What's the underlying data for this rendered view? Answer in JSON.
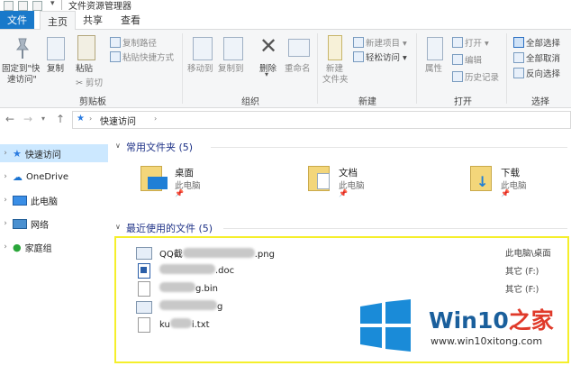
{
  "window": {
    "title": "文件资源管理器"
  },
  "tabs": {
    "file": "文件",
    "home": "主页",
    "share": "共享",
    "view": "查看"
  },
  "ribbon": {
    "clipboard": {
      "pin_quick_access_l1": "固定到\"快",
      "pin_quick_access_l2": "速访问\"",
      "copy": "复制",
      "paste": "粘贴",
      "copy_path": "复制路径",
      "paste_shortcut": "粘贴快捷方式",
      "cut": "剪切",
      "label": "剪贴板"
    },
    "organize": {
      "move_to": "移动到",
      "copy_to": "复制到",
      "delete": "删除",
      "rename": "重命名",
      "label": "组织"
    },
    "new": {
      "new_folder_l1": "新建",
      "new_folder_l2": "文件夹",
      "new_item": "新建项目",
      "easy_access": "轻松访问",
      "label": "新建"
    },
    "open": {
      "properties": "属性",
      "open": "打开",
      "edit": "编辑",
      "history": "历史记录",
      "label": "打开"
    },
    "select": {
      "select_all": "全部选择",
      "select_none": "全部取消",
      "invert": "反向选择",
      "label": "选择"
    }
  },
  "address": {
    "path": "快速访问"
  },
  "nav_pane": {
    "items": [
      {
        "label": "快速访问",
        "icon": "star-icon"
      },
      {
        "label": "OneDrive",
        "icon": "cloud-icon"
      },
      {
        "label": "此电脑",
        "icon": "computer-icon"
      },
      {
        "label": "网络",
        "icon": "network-icon"
      },
      {
        "label": "家庭组",
        "icon": "homegroup-icon"
      }
    ]
  },
  "frequent": {
    "header": "常用文件夹 (5)",
    "folders": [
      {
        "name": "桌面",
        "loc": "此电脑"
      },
      {
        "name": "文档",
        "loc": "此电脑"
      },
      {
        "name": "下载",
        "loc": "此电脑"
      }
    ]
  },
  "recent": {
    "header": "最近使用的文件 (5)",
    "files": [
      {
        "prefix": "QQ截",
        "suffix": ".png",
        "loc": "此电脑\\桌面"
      },
      {
        "prefix": "",
        "suffix": ".doc",
        "loc": "其它 (F:)"
      },
      {
        "prefix": "",
        "suffix": "g.bin",
        "loc": "其它 (F:)"
      },
      {
        "prefix": "",
        "suffix": "g",
        "loc": ""
      },
      {
        "prefix": "ku",
        "suffix": "i.txt",
        "loc": ""
      }
    ]
  },
  "watermark": {
    "brand_a": "Win10",
    "brand_b": "之家",
    "url": "www.win10xitong.com"
  },
  "colors": {
    "accent": "#1979ca",
    "selection": "#cce8ff",
    "highlight_box": "#f5ef2b",
    "section_text": "#1e3287"
  }
}
